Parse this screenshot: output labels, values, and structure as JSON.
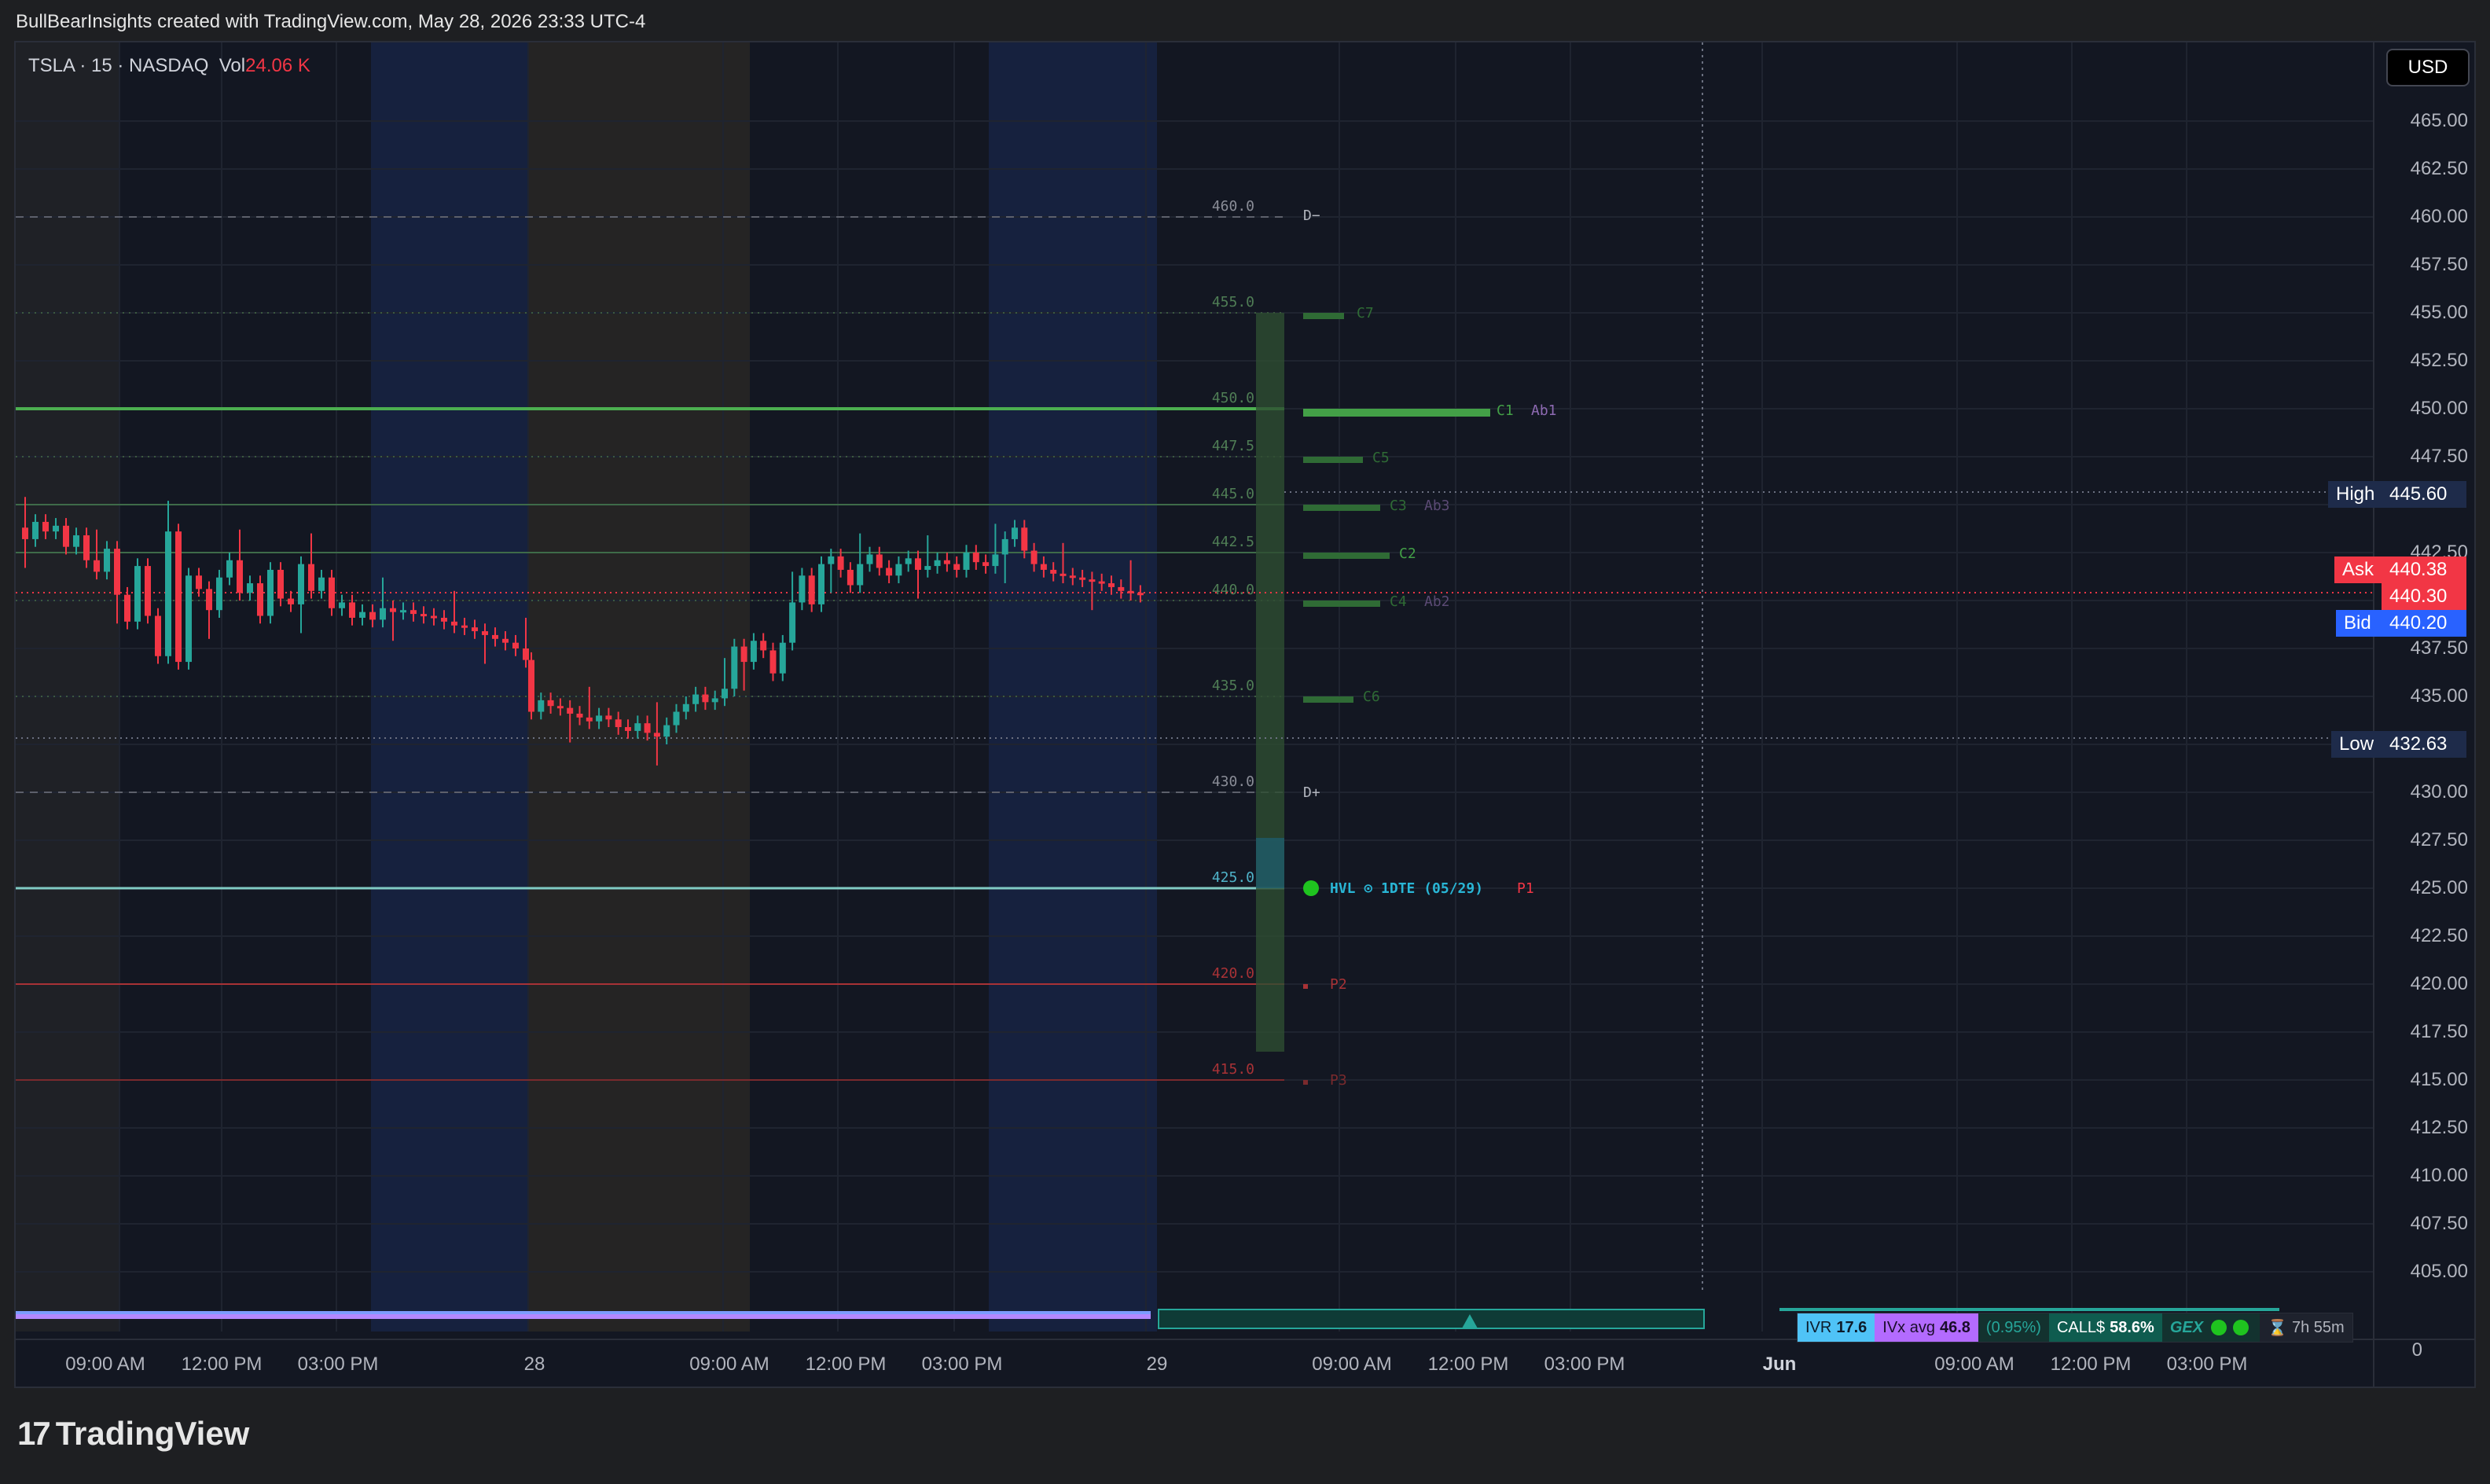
{
  "header": {
    "credit": "BullBearInsights created with TradingView.com, May 28, 2026 23:33 UTC-4"
  },
  "symbol": {
    "name": "TSLA · 15 · NASDAQ",
    "vol_label": "Vol",
    "vol_value": "24.06 K"
  },
  "currency_button": "USD",
  "price_axis": [
    "465.00",
    "462.50",
    "460.00",
    "457.50",
    "455.00",
    "452.50",
    "450.00",
    "447.50",
    "442.50",
    "437.50",
    "435.00",
    "430.00",
    "427.50",
    "425.00",
    "422.50",
    "420.00",
    "417.50",
    "415.00",
    "412.50",
    "410.00",
    "407.50",
    "405.00",
    "0"
  ],
  "price_tags": {
    "high_label": "High",
    "high_value": "445.60",
    "ask_label": "Ask",
    "ask_value": "440.38",
    "last_value": "440.30",
    "bid_label": "Bid",
    "bid_value": "440.20",
    "low_label": "Low",
    "low_value": "432.63"
  },
  "level_labels": [
    "460.0",
    "455.0",
    "450.0",
    "447.5",
    "445.0",
    "442.5",
    "440.0",
    "435.0",
    "430.0",
    "425.0",
    "420.0",
    "415.0"
  ],
  "gex_labels": {
    "d_minus": "D−",
    "d_plus": "D+",
    "c7": "C7",
    "c1": "C1",
    "ab1": "Ab1",
    "c5": "C5",
    "c3": "C3",
    "ab3": "Ab3",
    "c2": "C2",
    "c4": "C4",
    "ab2": "Ab2",
    "c6": "C6",
    "hvl": "HVL ⊙ 1DTE (05/29)",
    "p1": "P1",
    "p2": "P2",
    "p3": "P3"
  },
  "time_axis": [
    {
      "label": "09:00 AM"
    },
    {
      "label": "12:00 PM"
    },
    {
      "label": "03:00 PM"
    },
    {
      "label": "28"
    },
    {
      "label": "09:00 AM"
    },
    {
      "label": "12:00 PM"
    },
    {
      "label": "03:00 PM"
    },
    {
      "label": "29"
    },
    {
      "label": "09:00 AM"
    },
    {
      "label": "12:00 PM"
    },
    {
      "label": "03:00 PM"
    },
    {
      "label": "Jun"
    },
    {
      "label": "09:00 AM"
    },
    {
      "label": "12:00 PM"
    },
    {
      "label": "03:00 PM"
    }
  ],
  "status": {
    "ivr_label": "IVR",
    "ivr_value": "17.6",
    "ivx_label": "IVx avg",
    "ivx_value": "46.8",
    "pct": "(0.95%)",
    "calls_label": "CALL$",
    "calls_value": "58.6%",
    "gex_label": "GEX",
    "timer": "7h 55m"
  },
  "brand": {
    "name": "TradingView",
    "logo": "17"
  },
  "colors": {
    "up": "#26a69a",
    "down": "#f23645",
    "bg": "#131722",
    "ask": "#f23645",
    "bid": "#2962ff",
    "tag_dark": "#1e2b4a",
    "gex_green": "#43a047"
  }
}
